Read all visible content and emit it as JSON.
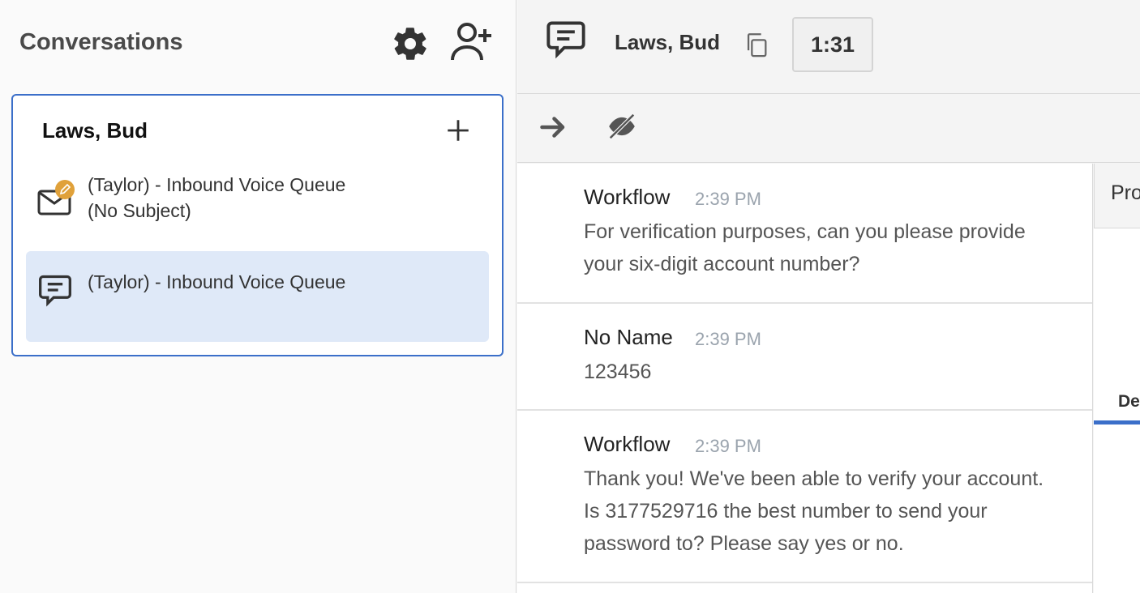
{
  "left_panel": {
    "title": "Conversations",
    "settings_icon": "gear-icon",
    "add_user_icon": "add-user-icon"
  },
  "conversation_card": {
    "contact_name": "Laws, Bud",
    "add_icon": "plus-icon",
    "items": [
      {
        "icon": "email-with-edit-badge-icon",
        "line1": "(Taylor) - Inbound Voice Queue",
        "line2": "(No Subject)",
        "selected": false
      },
      {
        "icon": "chat-icon",
        "line1": "(Taylor) - Inbound Voice Queue",
        "line2": "",
        "selected": true
      }
    ]
  },
  "header": {
    "contact_name": "Laws, Bud",
    "timer": "1:31",
    "copy_icon": "copy-icon",
    "chat_icon": "chat-icon"
  },
  "toolbar": {
    "transfer_icon": "arrow-right-icon",
    "visibility_icon": "eye-off-icon"
  },
  "messages": [
    {
      "sender": "Workflow",
      "time": "2:39 PM",
      "lines": [
        "For verification purposes, can you please provide",
        "your six-digit account number?"
      ]
    },
    {
      "sender": "No Name",
      "time": "2:39 PM",
      "lines": [
        "123456"
      ]
    },
    {
      "sender": "Workflow",
      "time": "2:39 PM",
      "lines": [
        "Thank you! We've been able to verify your account.",
        "Is 3177529716 the best number to send your",
        "password to? Please say yes or no."
      ]
    }
  ],
  "side_panel": {
    "top_label": "Pro",
    "tab_label": "De"
  },
  "colors": {
    "accent": "#3b6fc9",
    "selected_row": "#dfe9f8",
    "badge": "#e0a13a"
  }
}
